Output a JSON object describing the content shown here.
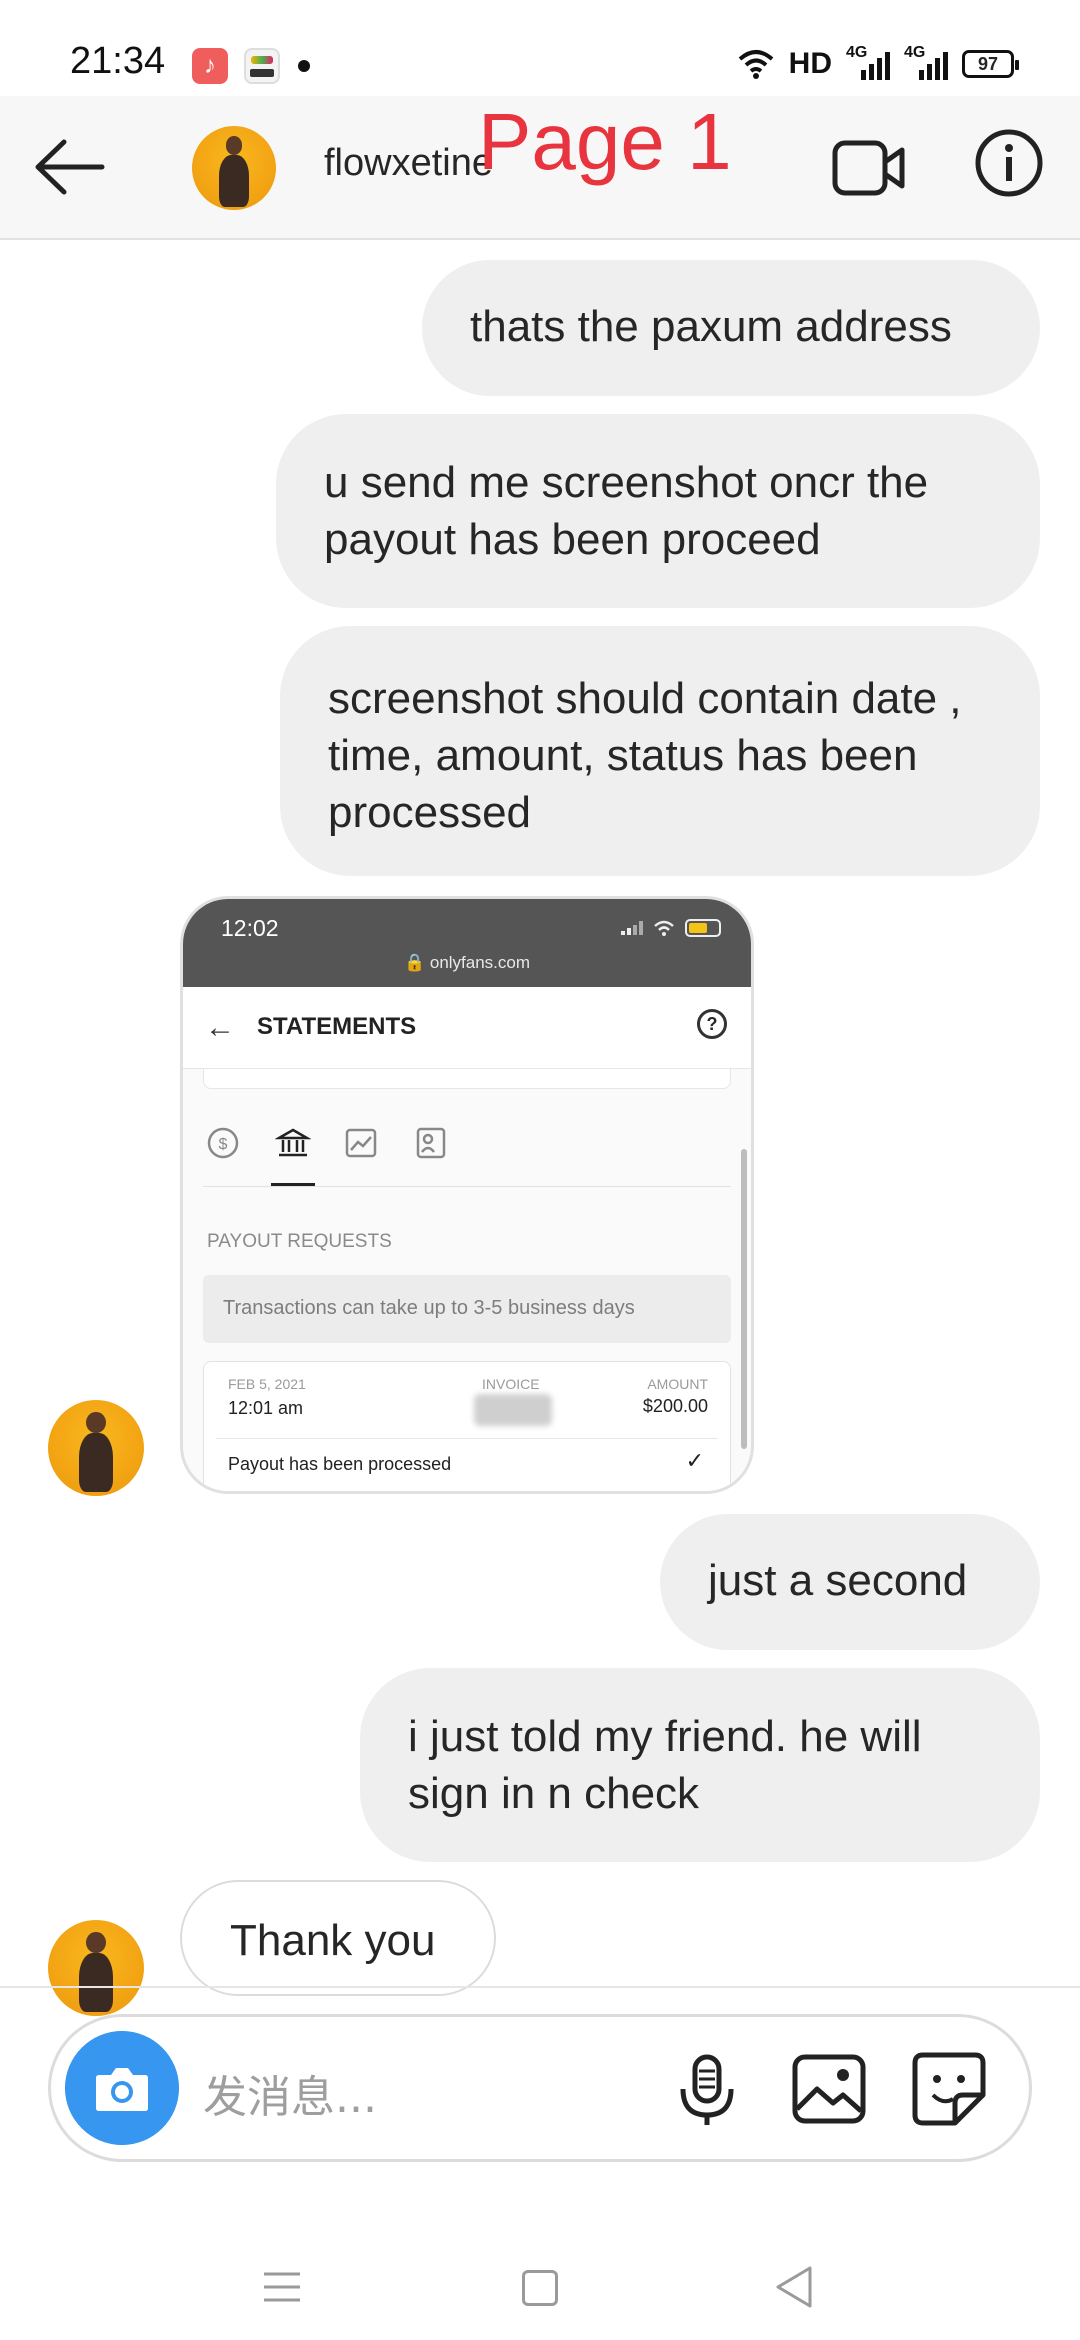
{
  "status_bar": {
    "time": "21:34",
    "hd": "HD",
    "net1": "4G",
    "net2": "4G",
    "battery": "97"
  },
  "header": {
    "username": "flowxetine",
    "overlay_label": "Page 1"
  },
  "messages": [
    {
      "from": "me",
      "text": "thats the paxum address"
    },
    {
      "from": "me",
      "text": "u send me screenshot oncr the payout has been proceed"
    },
    {
      "from": "me",
      "text": "screenshot should contain date , time, amount, status has been processed"
    },
    {
      "from": "them",
      "type": "image"
    },
    {
      "from": "me",
      "text": "just a second"
    },
    {
      "from": "me",
      "text": "i just told my friend. he will sign in n check"
    },
    {
      "from": "them",
      "text": "Thank you"
    }
  ],
  "shared_image": {
    "time": "12:02",
    "url": "onlyfans.com",
    "title": "STATEMENTS",
    "section": "PAYOUT REQUESTS",
    "note": "Transactions can take up to 3-5 business days",
    "date": "FEB 5, 2021",
    "time_value": "12:01 am",
    "invoice_label": "INVOICE",
    "amount_label": "AMOUNT",
    "amount": "$200.00",
    "status": "Payout has been processed"
  },
  "composer": {
    "placeholder": "发消息..."
  },
  "colors": {
    "accent_blue": "#3797f0",
    "bubble_gray": "#efefef",
    "overlay_red": "#e8343f"
  }
}
